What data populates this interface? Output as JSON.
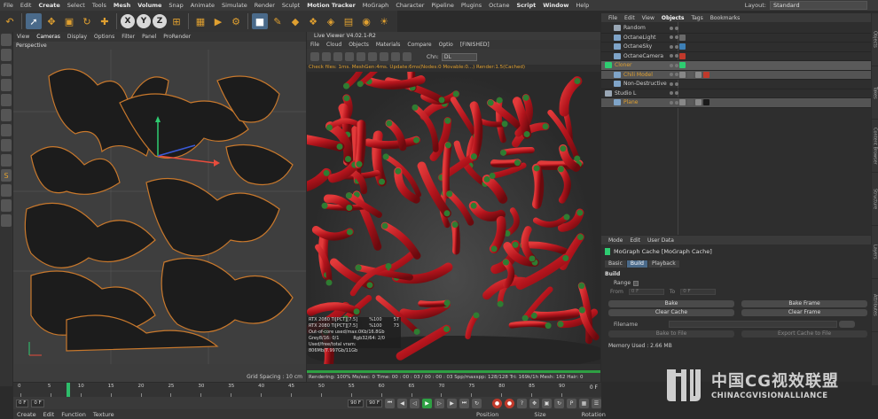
{
  "menubar": {
    "items": [
      "File",
      "Edit",
      "Create",
      "Select",
      "Tools",
      "Mesh",
      "Volume",
      "Snap",
      "Animate",
      "Simulate",
      "Render",
      "Sculpt",
      "Motion Tracker",
      "MoGraph",
      "Character",
      "Pipeline",
      "Plugins",
      "Octane",
      "Script",
      "Window",
      "Help"
    ],
    "bold_items": [
      "Create",
      "Mesh",
      "Volume",
      "Motion Tracker",
      "Script",
      "Window"
    ],
    "layout_label": "Layout:",
    "layout_value": "Standard"
  },
  "toolbar": {
    "axis_x": "X",
    "axis_y": "Y",
    "axis_z": "Z"
  },
  "left_tools": {
    "labels": [
      "",
      "",
      "",
      "",
      "",
      "",
      "",
      "",
      "",
      "S",
      "",
      "",
      ""
    ]
  },
  "viewport": {
    "menu": [
      "View",
      "Cameras",
      "Display",
      "Options",
      "Filter",
      "Panel",
      "ProRender"
    ],
    "active_menu": "Cameras",
    "label": "Perspective",
    "grid_spacing": "Grid Spacing : 10 cm"
  },
  "live_viewer": {
    "title": "Live Viewer V4.02.1-R2",
    "menu": [
      "File",
      "Cloud",
      "Objects",
      "Materials",
      "Compare",
      "Optio",
      "[FINISHED]"
    ],
    "chn_label": "Chn:",
    "chn_value": "DL",
    "status": "Check files: 1ms. MeshGen:4ms. Update:6ms(Nodes:0 Movable:0...) Render:1.5(Cached)",
    "stats": [
      {
        "label": "RTX 2080 Ti[PCT][7.5]",
        "a": "%100",
        "b": "57"
      },
      {
        "label": "RTX 2080 Ti[PCT][7.5]",
        "a": "%100",
        "b": "73"
      },
      {
        "label": "Out-of-core used/max:0Kb/16.8Gb",
        "a": "",
        "b": ""
      },
      {
        "label": "Grey8/16: 0/1",
        "a": "Rgb32/64: 2/0",
        "b": ""
      },
      {
        "label": "Used/free/total vram: 806Mb/7.997Gb/11Gb",
        "a": "",
        "b": ""
      }
    ],
    "bottom": "Rendering: 100%  Ms/sec: 0    Time: 00 : 00 : 03 / 00 : 00 : 03    Spp/maxspp: 128/128    Tri: 169k/1h    Mesh: 162    Hair: 0",
    "progress": 1.0
  },
  "object_manager": {
    "menu": [
      "File",
      "Edit",
      "View",
      "Objects",
      "Tags",
      "Bookmarks"
    ],
    "active_menu": "Objects",
    "objects": [
      {
        "name": "Random",
        "indent": 1,
        "icon_color": "#9aa7b5",
        "tags": []
      },
      {
        "name": "OctaneLight",
        "indent": 1,
        "icon_color": "#7fa4c8",
        "tags": [
          "#6a6a6a"
        ]
      },
      {
        "name": "OctaneSky",
        "indent": 1,
        "icon_color": "#7fa4c8",
        "tags": [
          "#3d7fb5"
        ]
      },
      {
        "name": "OctaneCamera",
        "indent": 1,
        "icon_color": "#7fa4c8",
        "tags": [
          "#c0392b"
        ]
      },
      {
        "name": "Cloner",
        "indent": 0,
        "icon_color": "#2ecc71",
        "tags": [
          "#2ecc71"
        ],
        "selected": true
      },
      {
        "name": "Chili Model",
        "indent": 1,
        "icon_color": "#7fa4c8",
        "tags": [
          "#888888",
          "#5a5a5a",
          "#888888",
          "#c0392b"
        ],
        "selected2": true
      },
      {
        "name": "Non-Destructive",
        "indent": 1,
        "icon_color": "#7fa4c8",
        "tags": []
      },
      {
        "name": "Studio L",
        "indent": 0,
        "icon_color": "#9aa7b5",
        "tags": []
      },
      {
        "name": "Plane",
        "indent": 1,
        "icon_color": "#7fa4c8",
        "tags": [
          "#888888",
          "#5a5a5a",
          "#888888",
          "#1a1a1a"
        ],
        "selected2": true
      }
    ]
  },
  "attribute_manager": {
    "menu": [
      "Mode",
      "Edit",
      "User Data"
    ],
    "title": "MoGraph Cache [MoGraph Cache]",
    "tabs": [
      "Basic",
      "Build",
      "Playback"
    ],
    "active_tab": "Build",
    "section": "Build",
    "range_label": "Range",
    "from_label": "From",
    "from_value": "0 F",
    "to_label": "To",
    "to_value": "0 F",
    "bake_label": "Bake",
    "bake_frame_label": "Bake Frame",
    "clear_cache_label": "Clear Cache",
    "clear_frame_label": "Clear Frame",
    "filename_label": "Filename",
    "bake_to_file_label": "Bake to File",
    "export_cache_label": "Export Cache to File",
    "memory_label": "Memory Used : 2.66 MB"
  },
  "side_tabs": [
    "Objects",
    "Takes",
    "Content Browser",
    "Structure",
    "Layers",
    "Attributes"
  ],
  "timeline": {
    "ticks": [
      "0",
      "5",
      "10",
      "15",
      "20",
      "25",
      "30",
      "35",
      "40",
      "45",
      "50",
      "55",
      "60",
      "65",
      "70",
      "75",
      "80",
      "85",
      "90"
    ],
    "current_frame_value": 8,
    "end_label": "0 F"
  },
  "transport": {
    "start_field": "0 F",
    "current_field": "0 F",
    "end_field": "90 F",
    "end_field2": "90 F"
  },
  "bottombar": {
    "menu": [
      "Create",
      "Edit",
      "Function",
      "Texture"
    ],
    "coords": [
      "Position",
      "Size",
      "Rotation"
    ]
  },
  "watermark": {
    "cn": "中国CG视效联盟",
    "en": "CHINACGVISIONALLIANCE"
  },
  "colors": {
    "accent_orange": "#e0a030",
    "chili_red": "#b3141c",
    "chili_stem": "#2e7d32",
    "selection_green": "#2ecc71"
  }
}
